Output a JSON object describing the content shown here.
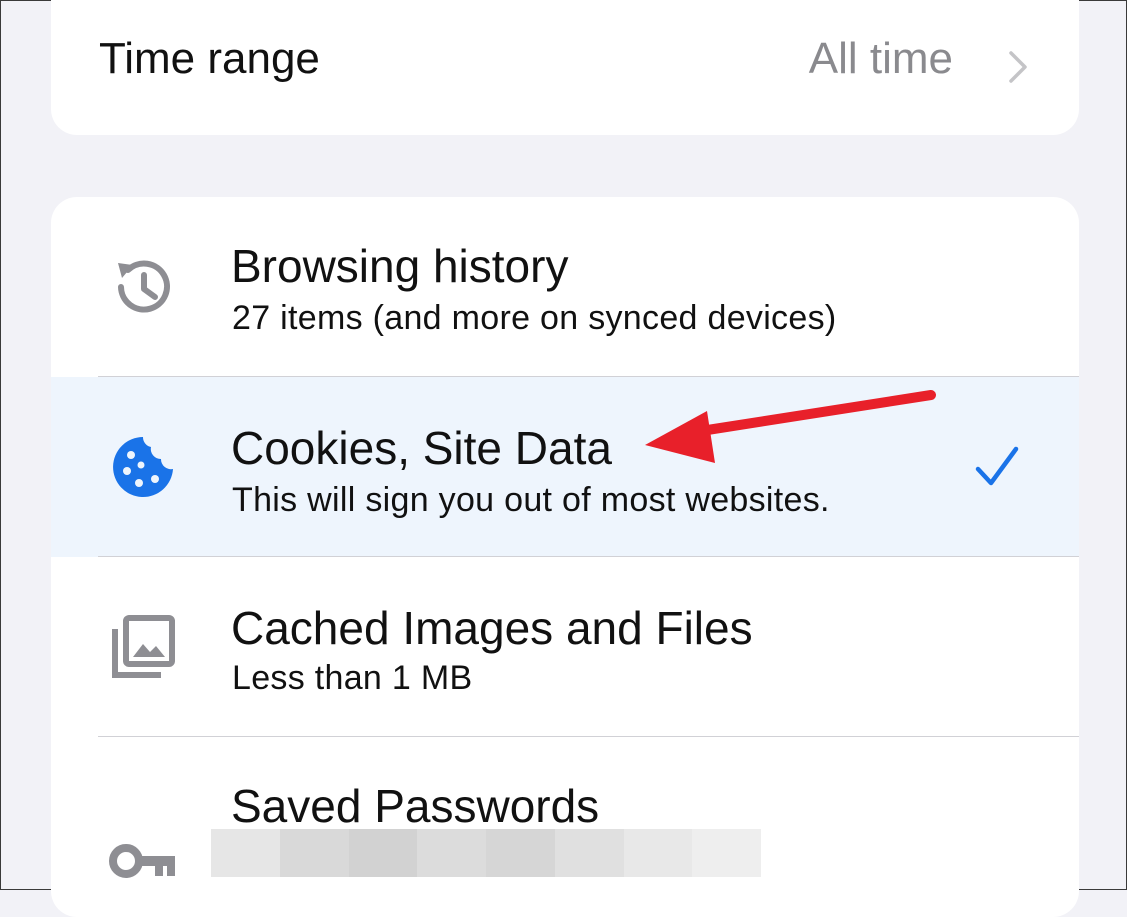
{
  "time_range": {
    "label": "Time range",
    "value": "All time",
    "chevron_icon": "chevron-right-icon"
  },
  "items": [
    {
      "title": "Browsing history",
      "subtitle": "27 items (and more on synced devices)",
      "icon": "history-icon",
      "selected": false
    },
    {
      "title": "Cookies, Site Data",
      "subtitle": "This will sign you out of most websites.",
      "icon": "cookie-icon",
      "selected": true
    },
    {
      "title": "Cached Images and Files",
      "subtitle": "Less than 1 MB",
      "icon": "images-icon",
      "selected": false
    },
    {
      "title": "Saved Passwords",
      "icon": "key-icon",
      "selected": false
    }
  ],
  "colors": {
    "accent": "#1a73e8",
    "selected_row_bg": "#eef5fd",
    "icon_gray": "#8e8e93",
    "annotation_arrow": "#e8202a",
    "page_bg": "#f2f2f7"
  }
}
